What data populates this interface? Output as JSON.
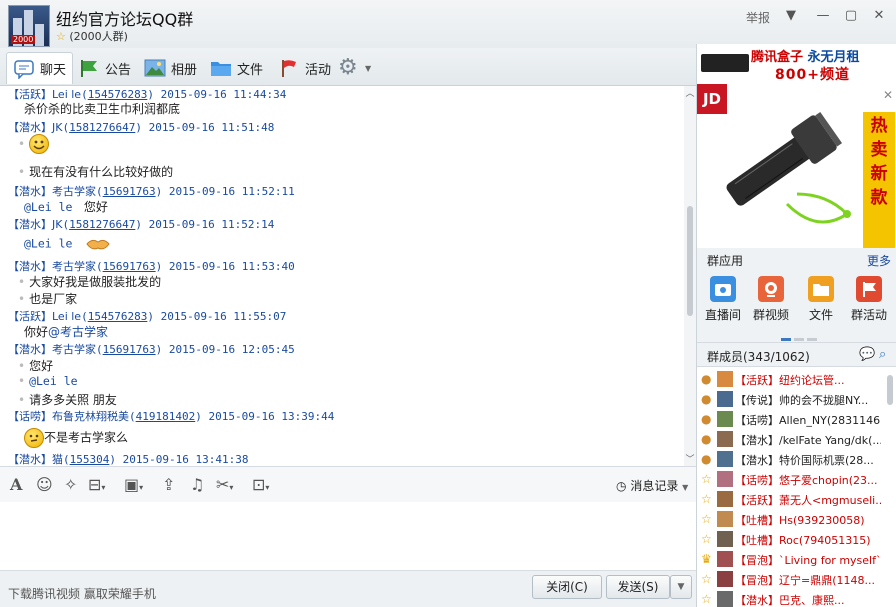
{
  "window": {
    "group_name": "纽约官方论坛QQ群",
    "group_size": "(2000人群)",
    "report": "举报",
    "avatar_badge": "2000"
  },
  "tabs": [
    {
      "label": "聊天",
      "icon": "chat-icon"
    },
    {
      "label": "公告",
      "icon": "flag-icon"
    },
    {
      "label": "相册",
      "icon": "album-icon"
    },
    {
      "label": "文件",
      "icon": "folder-icon"
    },
    {
      "label": "活动",
      "icon": "red-flag-icon"
    }
  ],
  "messages": [
    {
      "role": "【活跃】",
      "nick": "Lei le",
      "qq": "154576283",
      "time": "2015-09-16 11:44:34",
      "lines": [
        "杀价杀的比卖卫生巾利润都底"
      ]
    },
    {
      "role": "【潜水】",
      "nick": "JK",
      "qq": "1581276647",
      "time": "2015-09-16 11:51:48",
      "lines": [
        "",
        "现在有没有什么比较好做的"
      ]
    },
    {
      "role": "【潜水】",
      "nick": "考古学家",
      "qq": "15691763",
      "time": "2015-09-16 11:52:11",
      "mention": "@Lei le",
      "lines": [
        "您好"
      ]
    },
    {
      "role": "【潜水】",
      "nick": "JK",
      "qq": "1581276647",
      "time": "2015-09-16 11:52:14",
      "mention": "@Lei le",
      "lines": []
    },
    {
      "role": "【潜水】",
      "nick": "考古学家",
      "qq": "15691763",
      "time": "2015-09-16 11:53:40",
      "lines": [
        "大家好我是做服装批发的",
        "也是厂家"
      ]
    },
    {
      "role": "【活跃】",
      "nick": "Lei le",
      "qq": "154576283",
      "time": "2015-09-16 11:55:07",
      "lines": [
        "你好"
      ],
      "mention_inline": "@考古学家"
    },
    {
      "role": "【潜水】",
      "nick": "考古学家",
      "qq": "15691763",
      "time": "2015-09-16 12:05:45",
      "lines": [
        "您好",
        "",
        "请多多关照 朋友"
      ],
      "mention": "@Lei le"
    },
    {
      "role": "【话唠】",
      "nick": "布鲁克林翔税美",
      "qq": "419181402",
      "time": "2015-09-16 13:39:44",
      "lines": [
        "不是考古学家么"
      ]
    },
    {
      "role": "【潜水】",
      "nick": "猫",
      "qq": "155304",
      "time": "2015-09-16 13:41:38",
      "lines": []
    }
  ],
  "toolbar": {
    "history": "消息记录"
  },
  "bottom": {
    "ad_text": "下载腾讯视频 赢取荣耀手机",
    "close": "关闭(C)",
    "send": "发送(S)"
  },
  "sidebar": {
    "banner": {
      "line1_a": "腾讯盒子",
      "line1_b": "永无月租",
      "line2": "800+频道"
    },
    "jd_ad": {
      "logo": "JD",
      "hot": "热卖新款"
    },
    "apps_title": "群应用",
    "apps_more": "更多",
    "apps": [
      {
        "label": "直播间",
        "color": "#3b8fe0"
      },
      {
        "label": "群视频",
        "color": "#e8643a"
      },
      {
        "label": "文件",
        "color": "#f0a020"
      },
      {
        "label": "群活动",
        "color": "#e04a30"
      }
    ],
    "members_title": "群成员(343/1062)",
    "members": [
      {
        "text": "【活跃】纽约论坛管...",
        "red": true
      },
      {
        "text": "【传说】帅的会不拢腿NY...",
        "red": false
      },
      {
        "text": "【话唠】Allen_NY(2831146...",
        "red": false
      },
      {
        "text": "【潜水】/kelFate Yang/dk(...",
        "red": false
      },
      {
        "text": "【潜水】特价国际机票(28...",
        "red": false
      },
      {
        "text": "【话唠】悠子爱chopin(23...",
        "red": true
      },
      {
        "text": "【活跃】萧无人<mgmuseli...",
        "red": true
      },
      {
        "text": "【吐槽】Hs(939230058)",
        "red": true
      },
      {
        "text": "【吐槽】Roc(794051315)",
        "red": true
      },
      {
        "text": "【冒泡】`Living for myself`...",
        "red": true
      },
      {
        "text": "【冒泡】辽宁=鼎鼎(1148...",
        "red": true
      },
      {
        "text": "【潜水】巴克、康熙...",
        "red": true
      }
    ],
    "colors": {
      "red": "#cc0000",
      "link": "#1a4aa0",
      "accent": "#3c78c0"
    }
  }
}
